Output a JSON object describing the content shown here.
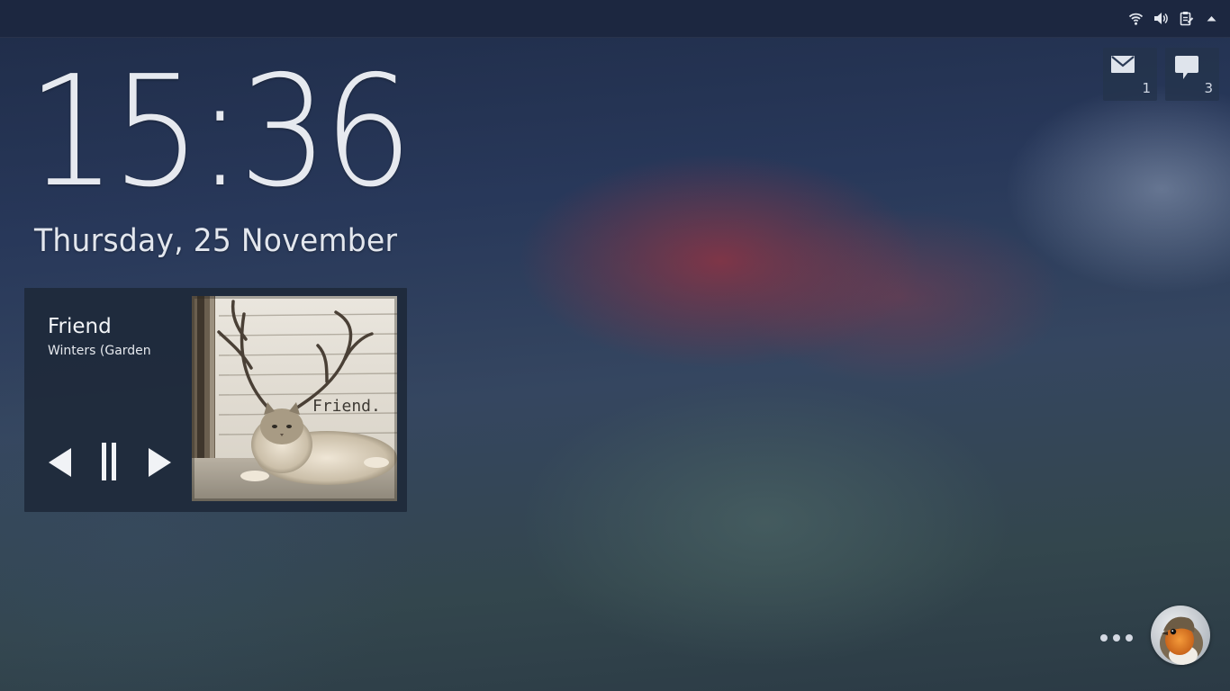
{
  "top_panel": {
    "tray_icons": [
      "wifi-icon",
      "volume-icon",
      "clipboard-icon",
      "arrow-up-icon"
    ]
  },
  "lockscreen": {
    "time": "15:36",
    "date": "Thursday, 25 November"
  },
  "media_player": {
    "title": "Friend",
    "artist": "Winters (Garden",
    "album_art_text": "Friend.",
    "controls": [
      "previous-icon",
      "pause-icon",
      "next-icon"
    ]
  },
  "notifications": [
    {
      "icon": "mail-icon",
      "count": "1"
    },
    {
      "icon": "chat-bubble-icon",
      "count": "3"
    }
  ],
  "user": {
    "avatar_icon": "robin-avatar",
    "more_icon": "more-dots-icon"
  },
  "colors": {
    "panel": "#1c2740",
    "card": "#1e293a",
    "tile": "#24344c",
    "text": "#eef1f6"
  }
}
